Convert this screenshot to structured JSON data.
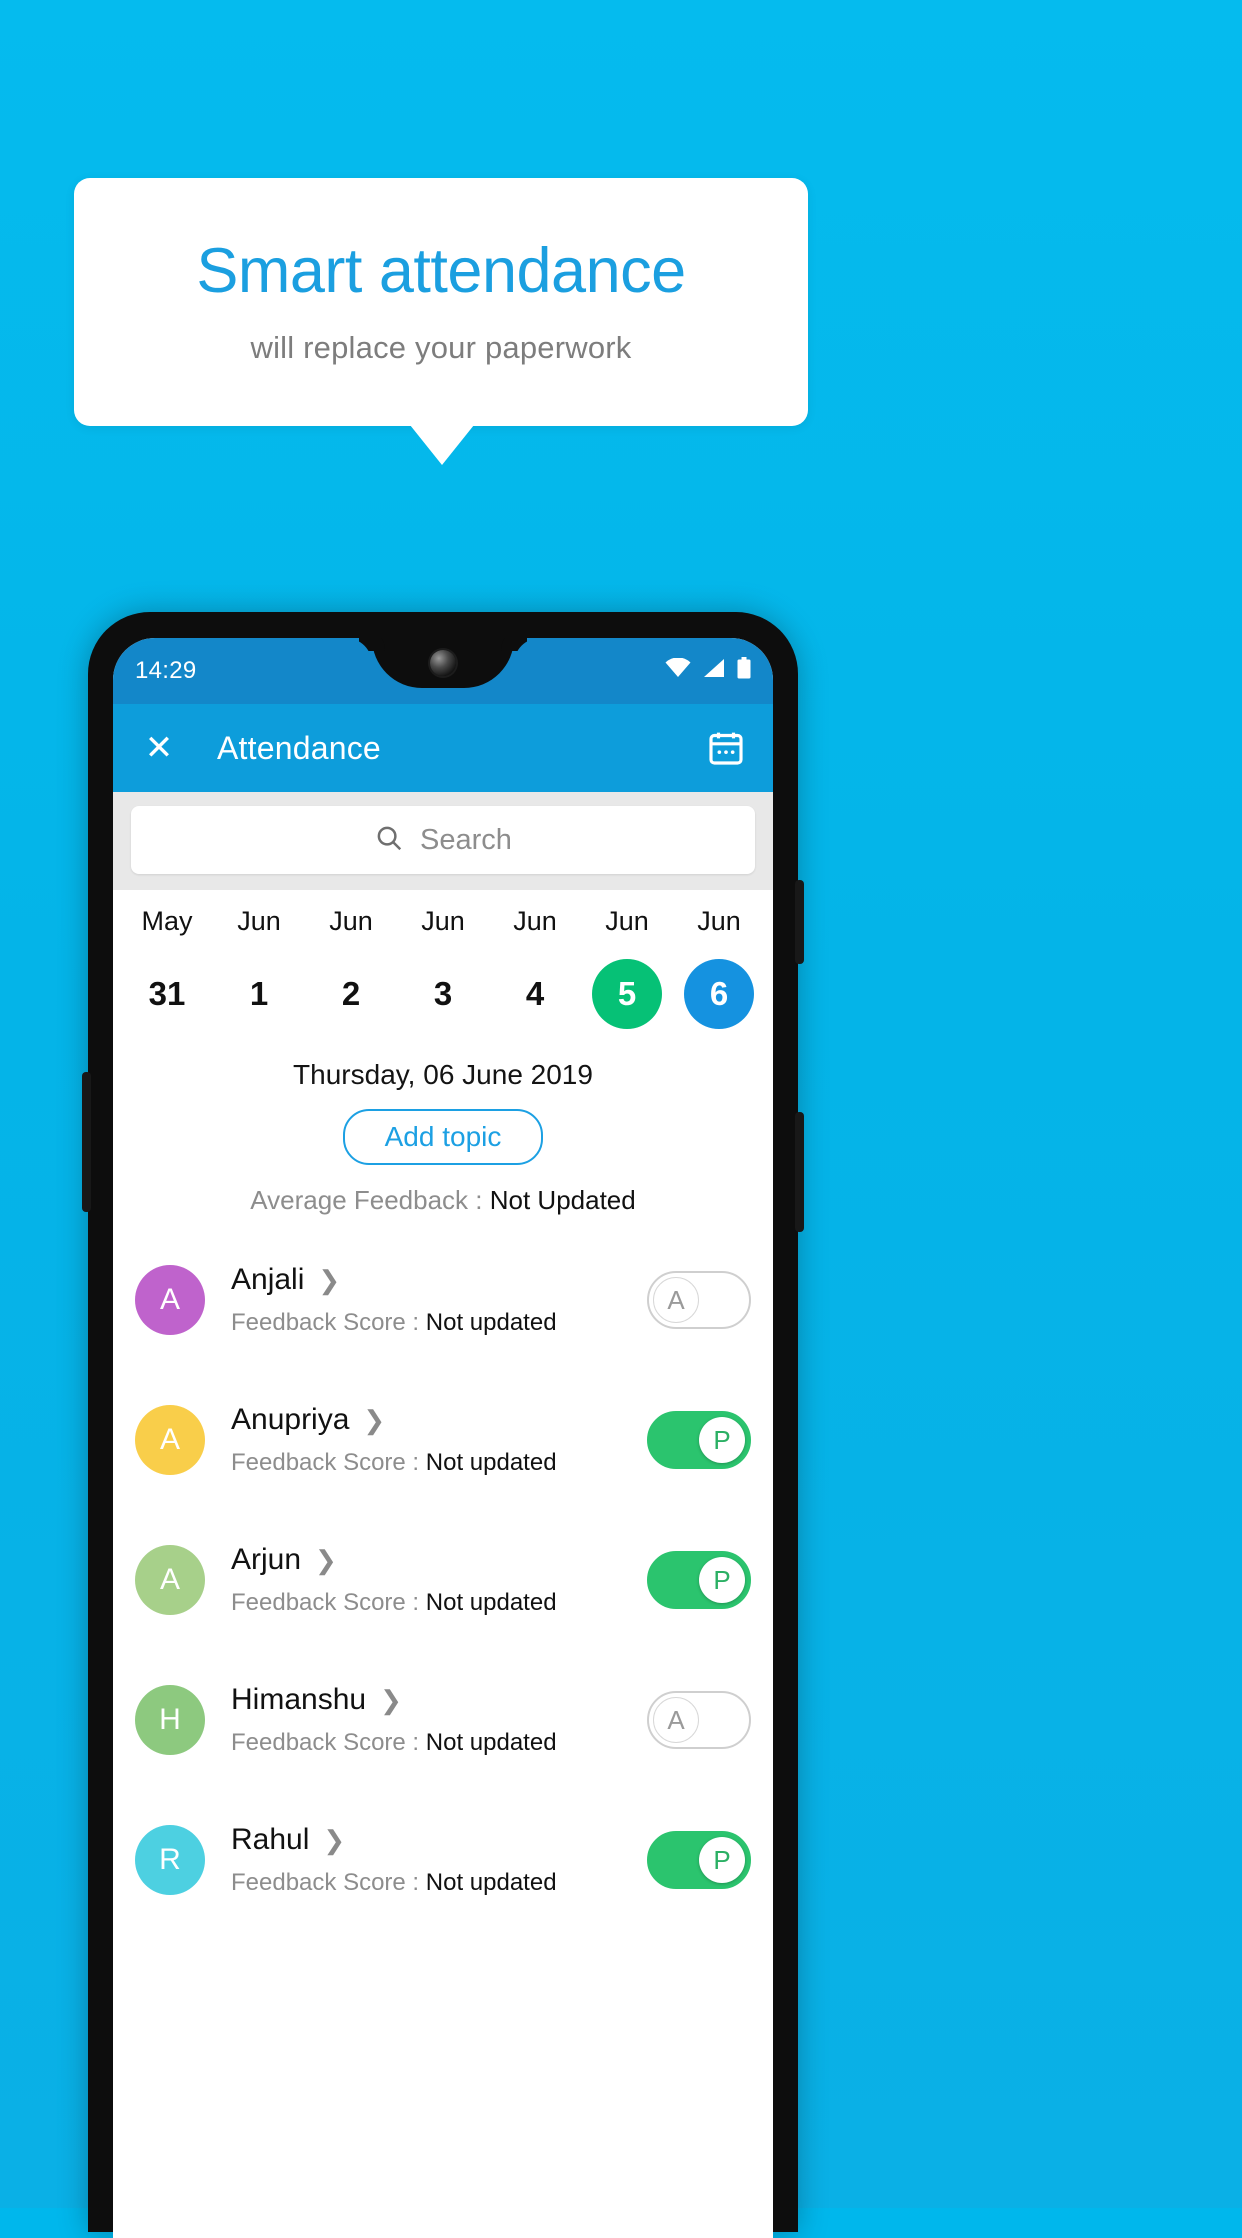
{
  "promo": {
    "headline": "Smart attendance",
    "subheadline": "will replace your paperwork",
    "background_color": "#04b4e8",
    "headline_color": "#1b9fe0",
    "card_color": "#ffffff"
  },
  "phone": {
    "statusbar": {
      "time": "14:29",
      "icons": [
        "wifi-icon",
        "signal-icon",
        "battery-icon"
      ],
      "background_color": "#1387c9"
    },
    "appbar": {
      "close_icon": "close-icon",
      "title": "Attendance",
      "action_icon": "calendar-icon",
      "background_color": "#0d9ddb"
    },
    "search": {
      "icon": "search-icon",
      "placeholder": "Search"
    },
    "date_strip": [
      {
        "month": "May",
        "day": "31",
        "state": "normal"
      },
      {
        "month": "Jun",
        "day": "1",
        "state": "normal"
      },
      {
        "month": "Jun",
        "day": "2",
        "state": "normal"
      },
      {
        "month": "Jun",
        "day": "3",
        "state": "normal"
      },
      {
        "month": "Jun",
        "day": "4",
        "state": "normal"
      },
      {
        "month": "Jun",
        "day": "5",
        "state": "today"
      },
      {
        "month": "Jun",
        "day": "6",
        "state": "selected"
      }
    ],
    "today_color": "#06c176",
    "selected_color": "#1592e0",
    "selected_date_label": "Thursday, 06 June 2019",
    "add_topic_label": "Add topic",
    "average_feedback_label": "Average Feedback : ",
    "average_feedback_value": "Not Updated",
    "feedback_score_label": "Feedback Score : ",
    "students": [
      {
        "name": "Anjali",
        "initial": "A",
        "avatar_color": "#bf63cc",
        "feedback_score": "Not updated",
        "attendance": "A",
        "attendance_state": "absent"
      },
      {
        "name": "Anupriya",
        "initial": "A",
        "avatar_color": "#f9ce4a",
        "feedback_score": "Not updated",
        "attendance": "P",
        "attendance_state": "present"
      },
      {
        "name": "Arjun",
        "initial": "A",
        "avatar_color": "#a7d08a",
        "feedback_score": "Not updated",
        "attendance": "P",
        "attendance_state": "present"
      },
      {
        "name": "Himanshu",
        "initial": "H",
        "avatar_color": "#8dc97f",
        "feedback_score": "Not updated",
        "attendance": "A",
        "attendance_state": "absent"
      },
      {
        "name": "Rahul",
        "initial": "R",
        "avatar_color": "#4dd0e1",
        "feedback_score": "Not updated",
        "attendance": "P",
        "attendance_state": "present"
      }
    ]
  }
}
